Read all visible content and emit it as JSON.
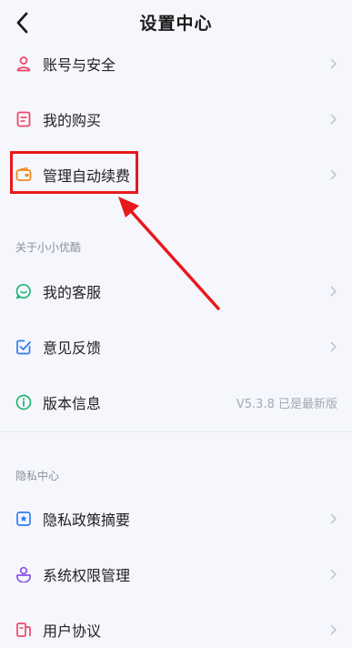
{
  "header": {
    "title": "设置中心"
  },
  "group1": [
    {
      "label": "账号与安全"
    },
    {
      "label": "我的购买"
    },
    {
      "label": "管理自动续费"
    }
  ],
  "about_section": {
    "title": "关于小小优酷",
    "items": [
      {
        "label": "我的客服"
      },
      {
        "label": "意见反馈"
      },
      {
        "label": "版本信息",
        "value": "V5.3.8 已是最新版"
      }
    ]
  },
  "privacy_section": {
    "title": "隐私中心",
    "items": [
      {
        "label": "隐私政策摘要"
      },
      {
        "label": "系统权限管理"
      },
      {
        "label": "用户协议"
      }
    ]
  },
  "colors": {
    "highlight": "#e8191c",
    "background": "#f5f7fd"
  }
}
